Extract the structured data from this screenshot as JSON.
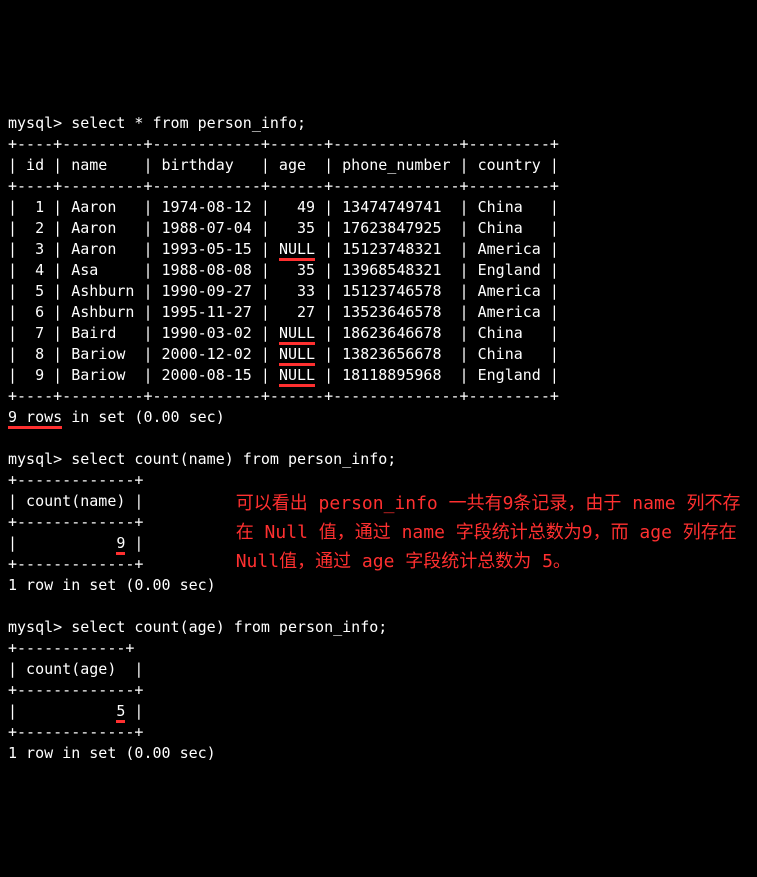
{
  "prompt": "mysql>",
  "queries": {
    "q1": "select * from person_info;",
    "q2": "select count(name) from person_info;",
    "q3": "select count(age) from person_info;"
  },
  "table1": {
    "sep": "+----+---------+------------+------+--------------+---------+",
    "hdr": "| id | name    | birthday   | age  | phone_number | country |",
    "rows": [
      {
        "id": "1",
        "name": "Aaron",
        "birthday": "1974-08-12",
        "age": "49",
        "phone": "13474749741",
        "country": "China"
      },
      {
        "id": "2",
        "name": "Aaron",
        "birthday": "1988-07-04",
        "age": "35",
        "phone": "17623847925",
        "country": "China"
      },
      {
        "id": "3",
        "name": "Aaron",
        "birthday": "1993-05-15",
        "age": "NULL",
        "phone": "15123748321",
        "country": "America"
      },
      {
        "id": "4",
        "name": "Asa",
        "birthday": "1988-08-08",
        "age": "35",
        "phone": "13968548321",
        "country": "England"
      },
      {
        "id": "5",
        "name": "Ashburn",
        "birthday": "1990-09-27",
        "age": "33",
        "phone": "15123746578",
        "country": "America"
      },
      {
        "id": "6",
        "name": "Ashburn",
        "birthday": "1995-11-27",
        "age": "27",
        "phone": "13523646578",
        "country": "America"
      },
      {
        "id": "7",
        "name": "Baird",
        "birthday": "1990-03-02",
        "age": "NULL",
        "phone": "18623646678",
        "country": "China"
      },
      {
        "id": "8",
        "name": "Bariow",
        "birthday": "2000-12-02",
        "age": "NULL",
        "phone": "13823656678",
        "country": "China"
      },
      {
        "id": "9",
        "name": "Bariow",
        "birthday": "2000-08-15",
        "age": "NULL",
        "phone": "18118895968",
        "country": "England"
      }
    ]
  },
  "status1_a": "9 rows",
  "status1_b": " in set (0.00 sec)",
  "table2": {
    "sep": "+-------------+",
    "hdr": "| count(name) |",
    "val": "9"
  },
  "status2": "1 row in set (0.00 sec)",
  "table3": {
    "sep": "+-------------+",
    "sep2": "+------------+",
    "hdr": "| count(age)  |",
    "val": "5"
  },
  "status3": "1 row in set (0.00 sec)",
  "comment": "可以看出 person_info 一共有9条记录，由于 name 列不存在 Null 值，通过 name 字段统计总数为9，而 age 列存在 Null值，通过 age 字段统计总数为 5。"
}
